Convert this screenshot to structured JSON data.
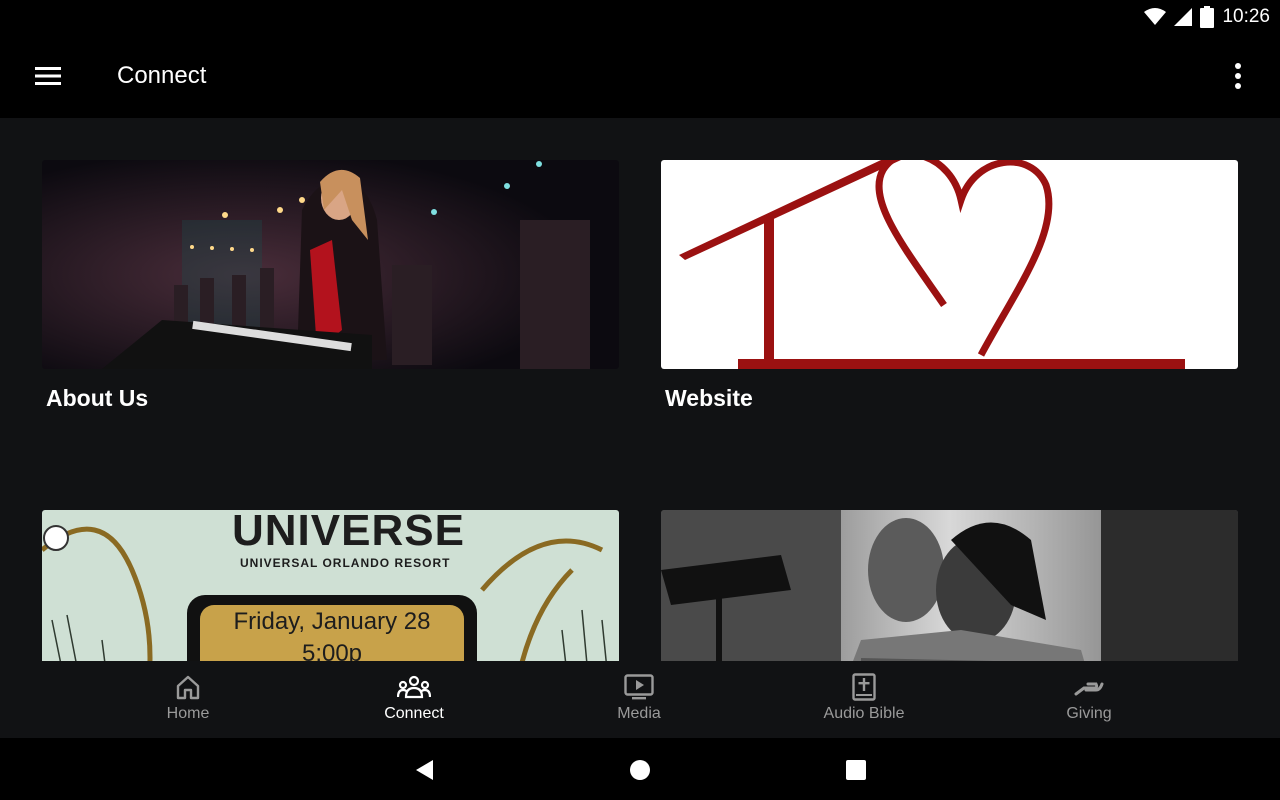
{
  "status": {
    "time": "10:26"
  },
  "app_bar": {
    "title": "Connect"
  },
  "cards": [
    {
      "label": "About Us"
    },
    {
      "label": "Website"
    },
    {
      "label": ""
    },
    {
      "label": ""
    }
  ],
  "card3_image": {
    "line1": "UNIVERSE",
    "line2": "UNIVERSAL ORLANDO RESORT",
    "date": "Friday, January 28",
    "time": "5:00p"
  },
  "bottom_nav": [
    {
      "label": "Home",
      "icon": "home-icon"
    },
    {
      "label": "Connect",
      "icon": "people-icon"
    },
    {
      "label": "Media",
      "icon": "media-icon"
    },
    {
      "label": "Audio Bible",
      "icon": "bible-icon"
    },
    {
      "label": "Giving",
      "icon": "giving-icon"
    }
  ],
  "colors": {
    "accent_red": "#9b1111",
    "surface": "#111214",
    "nav_inactive": "#9a9a9a"
  }
}
